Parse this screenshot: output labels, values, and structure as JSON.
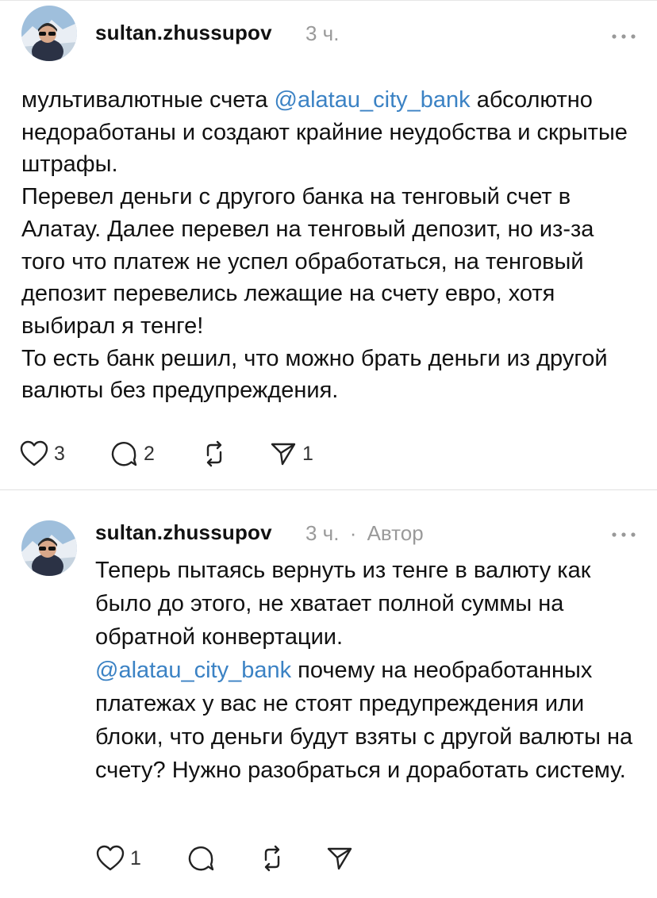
{
  "colors": {
    "mention": "#3b82c4",
    "meta": "#9a9a9a",
    "divider": "#e1e1e1"
  },
  "posts": [
    {
      "username": "sultan.zhussupov",
      "time": "3 ч.",
      "author_label": "",
      "paragraph1": {
        "before": "мультивалютные счета ",
        "mention": "@alatau_city_bank",
        "after": " абсолютно недоработаны и создают крайние неудобства и скрытые штрафы."
      },
      "paragraph2": "Перевел деньги с другого банка на тенговый счет в Алатау. Далее перевел на тенговый депозит, но из-за того что платеж не успел обработаться, на тенговый депозит перевелись лежащие на счету евро, хотя выбирал я тенге!",
      "paragraph3": "То есть банк решил, что можно брать деньги из другой валюты без предупреждения.",
      "like_count": "3",
      "reply_count": "2",
      "repost_count": "",
      "share_count": "1",
      "icons": [
        "heart-icon",
        "comment-icon",
        "repost-icon",
        "send-icon",
        "more-icon"
      ]
    },
    {
      "username": "sultan.zhussupov",
      "time": "3 ч.",
      "separator": "·",
      "author_label": "Автор",
      "paragraph1": "Теперь пытаясь вернуть из тенге в валюту как было до этого, не хватает полной суммы на обратной конвертации.",
      "paragraph2": {
        "mention": "@alatau_city_bank",
        "after": " почему на необработанных платежах у вас не стоят предупреждения или блоки, что деньги будут взяты с другой валюты на счету? Нужно разобраться и доработать систему."
      },
      "like_count": "1",
      "reply_count": "",
      "repost_count": "",
      "share_count": "",
      "icons": [
        "heart-icon",
        "comment-icon",
        "repost-icon",
        "send-icon",
        "more-icon"
      ]
    }
  ]
}
